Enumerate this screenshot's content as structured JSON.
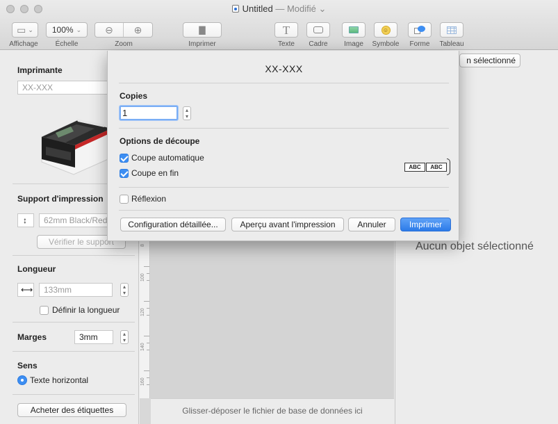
{
  "window": {
    "title": "Untitled",
    "title_separator": "—",
    "status": "Modifié",
    "status_chevron": "⌄"
  },
  "toolbar": {
    "view_label": "Affichage",
    "scale_label": "Échelle",
    "scale_value": "100%",
    "zoom_label": "Zoom",
    "print_label": "Imprimer",
    "text_label": "Texte",
    "frame_label": "Cadre",
    "image_label": "Image",
    "symbol_label": "Symbole",
    "shape_label": "Forme",
    "table_label": "Tableau"
  },
  "sidebar": {
    "printer_heading": "Imprimante",
    "printer_field": "XX-XXX",
    "media_heading": "Support d'impression",
    "media_value": "62mm Black/Red",
    "check_media_button": "Vérifier le support",
    "length_heading": "Longueur",
    "length_value": "133mm",
    "set_length_label": "Définir la longueur",
    "margins_label": "Marges",
    "margins_value": "3mm",
    "orientation_heading": "Sens",
    "orientation_value": "Texte horizontal",
    "buy_labels_button": "Acheter des étiquettes"
  },
  "canvas": {
    "ruler_labels": [
      "8",
      "100",
      "120",
      "140",
      "160"
    ],
    "drop_hint": "Glisser-déposer le fichier de base de données ici"
  },
  "right_panel": {
    "selected_button": "n sélectionné",
    "empty_message": "Aucun objet sélectionné"
  },
  "dialog": {
    "title": "XX-XXX",
    "copies_heading": "Copies",
    "copies_value": "1",
    "cut_heading": "Options de découpe",
    "auto_cut_label": "Coupe automatique",
    "auto_cut_checked": true,
    "end_cut_label": "Coupe en fin",
    "end_cut_checked": true,
    "abc_label": "ABC",
    "mirror_label": "Réflexion",
    "mirror_checked": false,
    "advanced_button": "Configuration détaillée...",
    "preview_button": "Aperçu avant l'impression",
    "cancel_button": "Annuler",
    "print_button": "Imprimer"
  },
  "colors": {
    "accent": "#3d8ef2",
    "window_bg": "#ececec",
    "canvas_bg": "#d8d8d8"
  }
}
